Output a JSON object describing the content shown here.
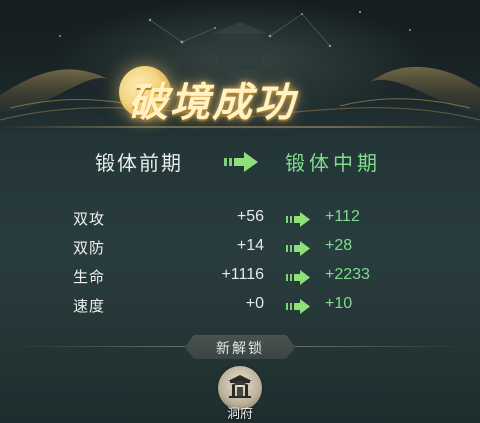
{
  "title": "破境成功",
  "realm": {
    "from": "锻体前期",
    "to": "锻体中期"
  },
  "stats": [
    {
      "label": "双攻",
      "old": "+56",
      "new": "+112"
    },
    {
      "label": "双防",
      "old": "+14",
      "new": "+28"
    },
    {
      "label": "生命",
      "old": "+1116",
      "new": "+2233"
    },
    {
      "label": "速度",
      "old": "+0",
      "new": "+10"
    }
  ],
  "unlock": {
    "header": "新解锁",
    "item_label": "洞府",
    "item_icon": "pavilion-icon"
  },
  "colors": {
    "upgrade_green": "#7fdc8c",
    "title_gold": "#fff1c2",
    "arrow_green": "#8fe07a"
  }
}
